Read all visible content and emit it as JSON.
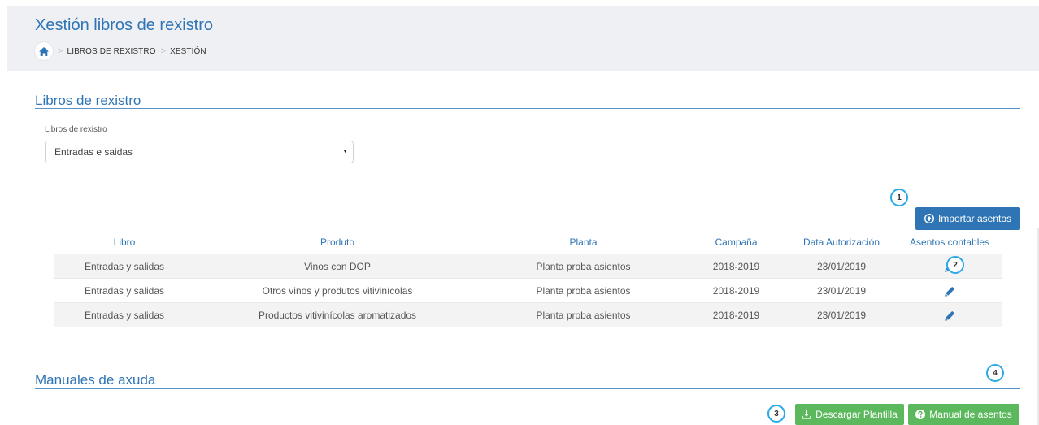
{
  "header": {
    "title": "Xestión libros de rexistro",
    "breadcrumb": [
      "LIBROS DE REXISTRO",
      "XESTIÓN"
    ]
  },
  "libros_section": {
    "title": "Libros de rexistro",
    "select_label": "Libros de rexistro",
    "select_value": "Entradas e saidas"
  },
  "badges": [
    "1",
    "2",
    "3",
    "4"
  ],
  "import_button": {
    "label": "Importar asentos"
  },
  "table": {
    "columns": [
      "Libro",
      "Produto",
      "Planta",
      "Campaña",
      "Data Autorización",
      "Asentos contables"
    ],
    "rows": [
      [
        "Entradas y salidas",
        "Vinos con DOP",
        "Planta proba asientos",
        "2018-2019",
        "23/01/2019"
      ],
      [
        "Entradas y salidas",
        "Otros vinos y produtos vitivinícolas",
        "Planta proba asientos",
        "2018-2019",
        "23/01/2019"
      ],
      [
        "Entradas y salidas",
        "Productos vitivinícolas aromatizados",
        "Planta proba asientos",
        "2018-2019",
        "23/01/2019"
      ]
    ]
  },
  "manuals_section": {
    "title": "Manuales de axuda",
    "download_button": "Descargar Plantilla",
    "manual_button": "Manual de asentos"
  },
  "colors": {
    "primary": "#2f75b5",
    "success": "#5cb85c",
    "badge_border": "#29a9e6",
    "header_bg": "#eef0f4"
  },
  "icons": {
    "home": "home-icon",
    "import": "upload-circle-icon",
    "edit": "pencil-icon",
    "download": "download-icon",
    "help": "question-circle-icon"
  }
}
